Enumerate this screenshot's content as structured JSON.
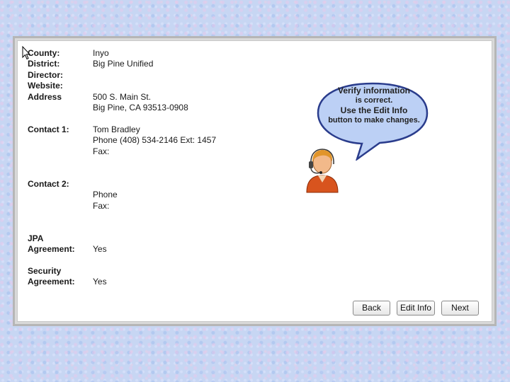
{
  "record": {
    "county_label": "County:",
    "county_value": "Inyo",
    "district_label": "District:",
    "district_value": "Big Pine Unified",
    "director_label": "Director:",
    "director_value": "",
    "website_label": "Website:",
    "website_value": "",
    "address_label": "Address",
    "address_line1": "500 S. Main St.",
    "address_line2": "Big Pine, CA 93513-0908",
    "contact1_label": "Contact 1:",
    "contact1_name": "Tom Bradley",
    "contact1_phone": "Phone  (408) 534-2146 Ext: 1457",
    "contact1_fax": "Fax:",
    "contact2_label": "Contact 2:",
    "contact2_phone": "Phone",
    "contact2_fax": "Fax:",
    "jpa_label_line1": "JPA",
    "jpa_label_line2": "Agreement:",
    "jpa_value": "Yes",
    "security_label_line1": "Security",
    "security_label_line2": "Agreement:",
    "security_value": "Yes"
  },
  "callout": {
    "line1": "Verify information",
    "line2": "is correct.",
    "line3": "Use   the Edit Info",
    "line4": "button to make changes."
  },
  "buttons": {
    "back": "Back",
    "edit": "Edit Info",
    "next": "Next"
  },
  "colors": {
    "bubble_fill": "#bcd0f5",
    "bubble_stroke": "#2a3c8c",
    "agent_shirt": "#d8541e"
  },
  "icons": {
    "cursor": "arrow-cursor-icon",
    "agent": "support-agent-headset-icon"
  }
}
